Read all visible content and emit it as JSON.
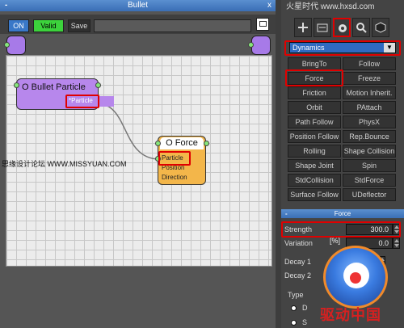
{
  "editor": {
    "title": "Bullet",
    "minimize": "-",
    "close": "x",
    "toolbar": {
      "on_label": "ON",
      "valid_label": "Valid",
      "save_label": "Save"
    },
    "nodes": {
      "bullet": {
        "title": "O Bullet Particle",
        "output": "*Particle"
      },
      "force": {
        "title": "O Force",
        "inputs": [
          "Particle",
          "Position",
          "Direction"
        ]
      }
    },
    "watermark": "思缘设计论坛  WWW.MISSYUAN.COM"
  },
  "panel": {
    "site_logo": "火星时代 www.hxsd.com",
    "dropdown": {
      "value": "Dynamics",
      "arrow": "▼"
    },
    "buttons": [
      [
        "BringTo",
        "Follow"
      ],
      [
        "Force",
        "Freeze"
      ],
      [
        "Friction",
        "Motion Inherit."
      ],
      [
        "Orbit",
        "PAttach"
      ],
      [
        "Path Follow",
        "PhysX"
      ],
      [
        "Position Follow",
        "Rep.Bounce"
      ],
      [
        "Rolling",
        "Shape Collision"
      ],
      [
        "Shape Joint",
        "Spin"
      ],
      [
        "StdCollision",
        "StdForce"
      ],
      [
        "Surface Follow",
        "UDeflector"
      ]
    ],
    "force_rollout": {
      "title": "Force",
      "dash": "-",
      "strength_label": "Strength",
      "strength_value": "300.0",
      "variation_label": "Variation",
      "variation_unit": "[%]",
      "variation_value": "0.0",
      "decay1_label": "Decay 1",
      "decay2_label": "Decay 2",
      "type_label": "Type",
      "type_option_1": "D",
      "type_option_2": "S"
    }
  },
  "brand": {
    "text": "驱动中国",
    "colors": {
      "ring": "#f08a2a",
      "text": "#d62020"
    }
  }
}
